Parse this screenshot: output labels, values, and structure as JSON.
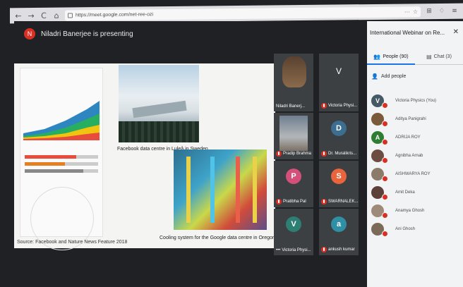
{
  "browser": {
    "nav": [
      "←",
      "→",
      "C",
      "⌂"
    ],
    "url": "https://meet.google.com/net-ree-ozi",
    "toolbar": [
      "⋯",
      "☆",
      "⊞",
      "♢",
      "≡"
    ]
  },
  "meet": {
    "presenter_initial": "N",
    "presenter_text": "Niladri Banerjee is presenting",
    "slide": {
      "caption1": "Facebook data centre in Luleå in Sweden",
      "caption2": "Cooling system for the Google data centre in Oregon",
      "source": "Source: Facebook and Nature News Feature 2018"
    },
    "tiles": [
      {
        "name": "Niladri Banerj...",
        "type": "video"
      },
      {
        "name": "Victoria Physi...",
        "initial": "V",
        "color": "#3c4043"
      },
      {
        "name": "Pradip Brahma",
        "type": "video2"
      },
      {
        "name": "Dr. Muralikris...",
        "initial": "D",
        "color": "#3b6e8f"
      },
      {
        "name": "Pratibha Pal",
        "initial": "P",
        "color": "#d4507a"
      },
      {
        "name": "SWARNALEK...",
        "initial": "S",
        "color": "#e8643c"
      },
      {
        "name": "Victoria Physi...",
        "initial": "V",
        "color": "#2d7f74",
        "prefix": "•••"
      },
      {
        "name": "ankush kumar",
        "initial": "a",
        "color": "#2f8fa5"
      }
    ]
  },
  "sidebar": {
    "title": "International Webinar on Re...",
    "tab_people": "People (90)",
    "tab_chat": "Chat (3)",
    "add_people": "Add people",
    "people": [
      {
        "name": "Victoria Physics (You)",
        "initial": "V",
        "color": "#455a64"
      },
      {
        "name": "Aditya Panigrahi",
        "initial": "",
        "color": "#7a5a3a"
      },
      {
        "name": "ADRIJA ROY",
        "initial": "A",
        "color": "#2e7d32"
      },
      {
        "name": "Agnibha Arnab",
        "initial": "",
        "color": "#6d4c41"
      },
      {
        "name": "AISHWARYA ROY",
        "initial": "",
        "color": "#8d7b6a"
      },
      {
        "name": "Amit Deka",
        "initial": "",
        "color": "#5d4037"
      },
      {
        "name": "Anamya Ghosh",
        "initial": "",
        "color": "#9e8a78"
      },
      {
        "name": "Ani Ghosh",
        "initial": "",
        "color": "#7b6a58"
      }
    ]
  }
}
